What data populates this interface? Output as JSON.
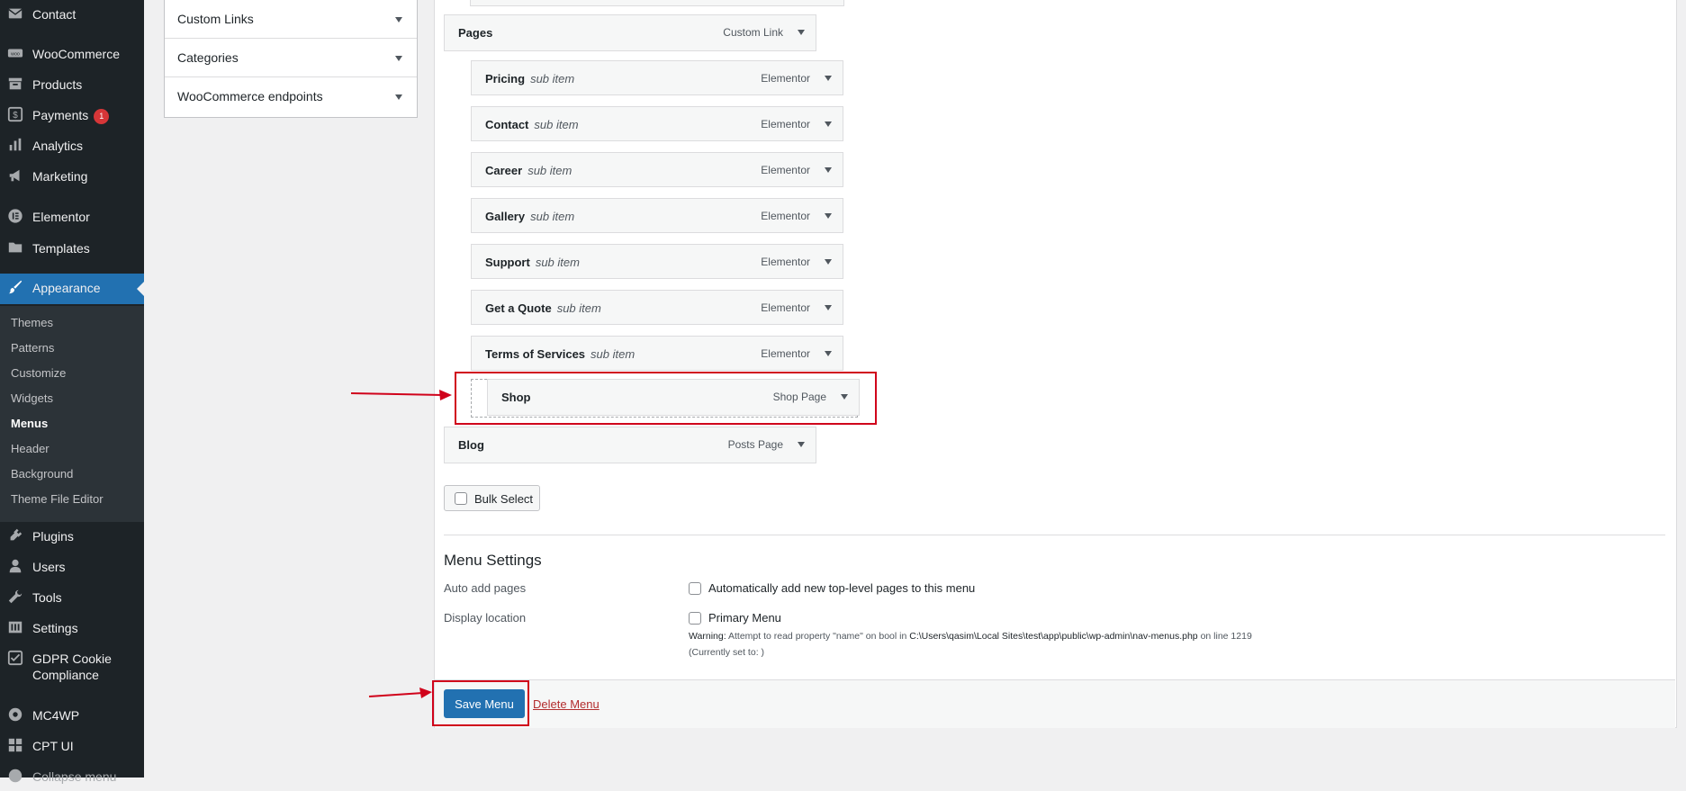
{
  "sidebar": {
    "items": [
      {
        "label": "Contact",
        "icon": "mail-icon"
      },
      {
        "label": "WooCommerce",
        "icon": "woocommerce-icon"
      },
      {
        "label": "Products",
        "icon": "archive-icon"
      },
      {
        "label": "Payments",
        "icon": "dollar-icon",
        "badge": "1"
      },
      {
        "label": "Analytics",
        "icon": "bar-chart-icon"
      },
      {
        "label": "Marketing",
        "icon": "megaphone-icon"
      },
      {
        "label": "Elementor",
        "icon": "elementor-icon"
      },
      {
        "label": "Templates",
        "icon": "folder-icon"
      },
      {
        "label": "Appearance",
        "icon": "paintbrush-icon"
      },
      {
        "label": "Plugins",
        "icon": "plug-icon"
      },
      {
        "label": "Users",
        "icon": "user-icon"
      },
      {
        "label": "Tools",
        "icon": "wrench-icon"
      },
      {
        "label": "Settings",
        "icon": "sliders-icon"
      },
      {
        "label": "GDPR Cookie",
        "label2": "Compliance",
        "icon": "shield-check-icon"
      },
      {
        "label": "MC4WP",
        "icon": "mc4wp-icon"
      },
      {
        "label": "CPT UI",
        "icon": "grid-icon"
      },
      {
        "label": "Collapse menu",
        "icon": "collapse-icon"
      }
    ],
    "submenu": [
      "Themes",
      "Patterns",
      "Customize",
      "Widgets",
      "Menus",
      "Header",
      "Background",
      "Theme File Editor"
    ],
    "active_color": "#2271b1"
  },
  "left_panel": {
    "sections": [
      "Custom Links",
      "Categories",
      "WooCommerce endpoints"
    ]
  },
  "menu_items": {
    "pages": {
      "title": "Pages",
      "type": "Custom Link"
    },
    "children": [
      {
        "title": "Pricing",
        "sub": "sub item",
        "type": "Elementor"
      },
      {
        "title": "Contact",
        "sub": "sub item",
        "type": "Elementor"
      },
      {
        "title": "Career",
        "sub": "sub item",
        "type": "Elementor"
      },
      {
        "title": "Gallery",
        "sub": "sub item",
        "type": "Elementor"
      },
      {
        "title": "Support",
        "sub": "sub item",
        "type": "Elementor"
      },
      {
        "title": "Get a Quote",
        "sub": "sub item",
        "type": "Elementor"
      },
      {
        "title": "Terms of Services",
        "sub": "sub item",
        "type": "Elementor"
      }
    ],
    "shop": {
      "title": "Shop",
      "type": "Shop Page"
    },
    "blog": {
      "title": "Blog",
      "type": "Posts Page"
    }
  },
  "bulk_select_label": "Bulk Select",
  "menu_settings": {
    "title": "Menu Settings",
    "auto_add_label": "Auto add pages",
    "auto_add_option": "Automatically add new top-level pages to this menu",
    "display_location_label": "Display location",
    "primary_menu_option": "Primary Menu",
    "warning_prefix": "Warning:",
    "warning_text": "Attempt to read property \"name\" on bool in",
    "warning_path": "C:\\Users\\qasim\\Local Sites\\test\\app\\public\\wp-admin\\nav-menus.php",
    "warning_suffix": "on line 1219",
    "currently_set": "(Currently set to: )"
  },
  "actions": {
    "save_label": "Save Menu",
    "delete_label": "Delete Menu"
  },
  "annotation_color": "#d0021b"
}
